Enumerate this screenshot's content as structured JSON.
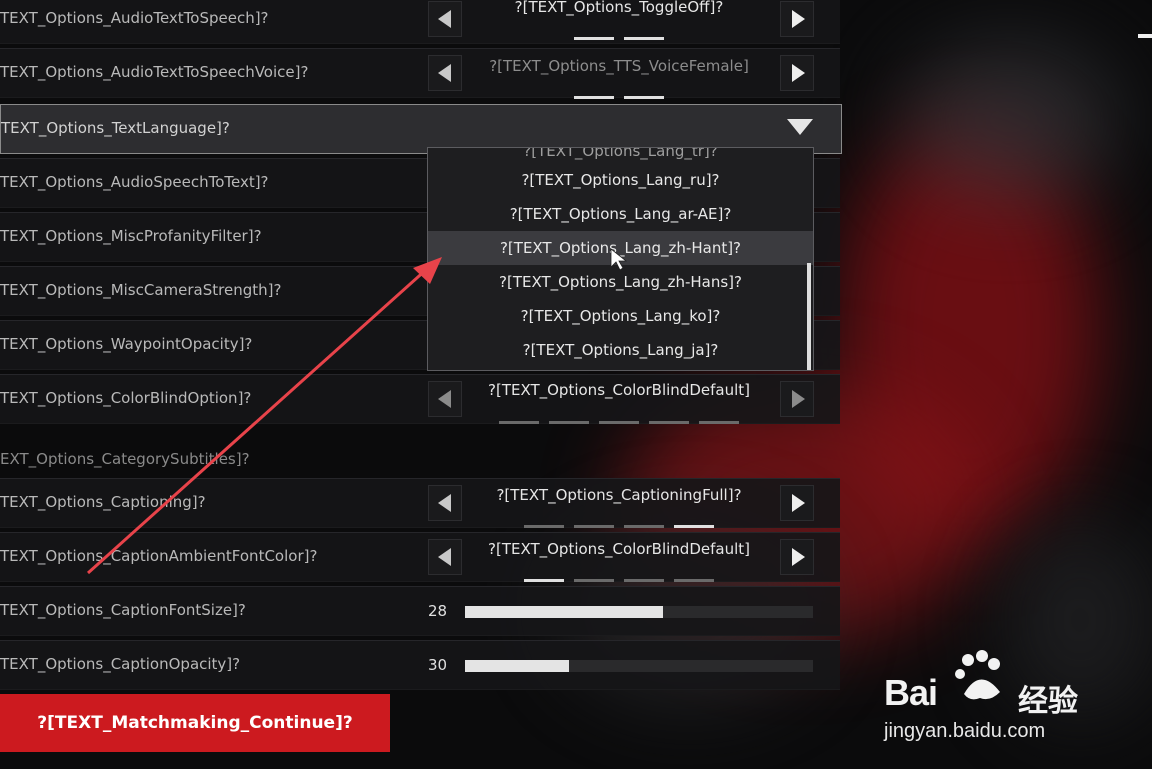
{
  "rows": [
    {
      "label": "TEXT_Options_AudioTextToSpeech]?",
      "value": "?[TEXT_Options_ToggleOff]?"
    },
    {
      "label": "TEXT_Options_AudioTextToSpeechVoice]?",
      "value": "?[TEXT_Options_TTS_VoiceFemale]"
    },
    {
      "label": "TEXT_Options_TextLanguage]?"
    },
    {
      "label": "TEXT_Options_AudioSpeechToText]?"
    },
    {
      "label": "TEXT_Options_MiscProfanityFilter]?"
    },
    {
      "label": "TEXT_Options_MiscCameraStrength]?"
    },
    {
      "label": "TEXT_Options_WaypointOpacity]?"
    },
    {
      "label": "TEXT_Options_ColorBlindOption]?",
      "value": "?[TEXT_Options_ColorBlindDefault]"
    }
  ],
  "section_title": "EXT_Options_CategorySubtitles]?",
  "subtitle_rows": [
    {
      "label": "TEXT_Options_Captioning]?",
      "value": "?[TEXT_Options_CaptioningFull]?"
    },
    {
      "label": "TEXT_Options_CaptionAmbientFontColor]?",
      "value": "?[TEXT_Options_ColorBlindDefault]"
    },
    {
      "label": "TEXT_Options_CaptionFontSize]?",
      "number": "28",
      "fill_percent": 57
    },
    {
      "label": "TEXT_Options_CaptionOpacity]?",
      "number": "30",
      "fill_percent": 30
    }
  ],
  "language_menu": {
    "options": [
      "?[TEXT_Options_Lang_tr]?",
      "?[TEXT_Options_Lang_ru]?",
      "?[TEXT_Options_Lang_ar-AE]?",
      "?[TEXT_Options_Lang_zh-Hant]?",
      "?[TEXT_Options_Lang_zh-Hans]?",
      "?[TEXT_Options_Lang_ko]?",
      "?[TEXT_Options_Lang_ja]?"
    ],
    "hovered": "?[TEXT_Options_Lang_zh-Hant]?"
  },
  "continue_button": "?[TEXT_Matchmaking_Continue]?",
  "watermark": {
    "brand": "Bai du 经验",
    "url": "jingyan.baidu.com"
  },
  "colors": {
    "accent": "#cc1a1f",
    "annotation_arrow": "#e8434a"
  }
}
